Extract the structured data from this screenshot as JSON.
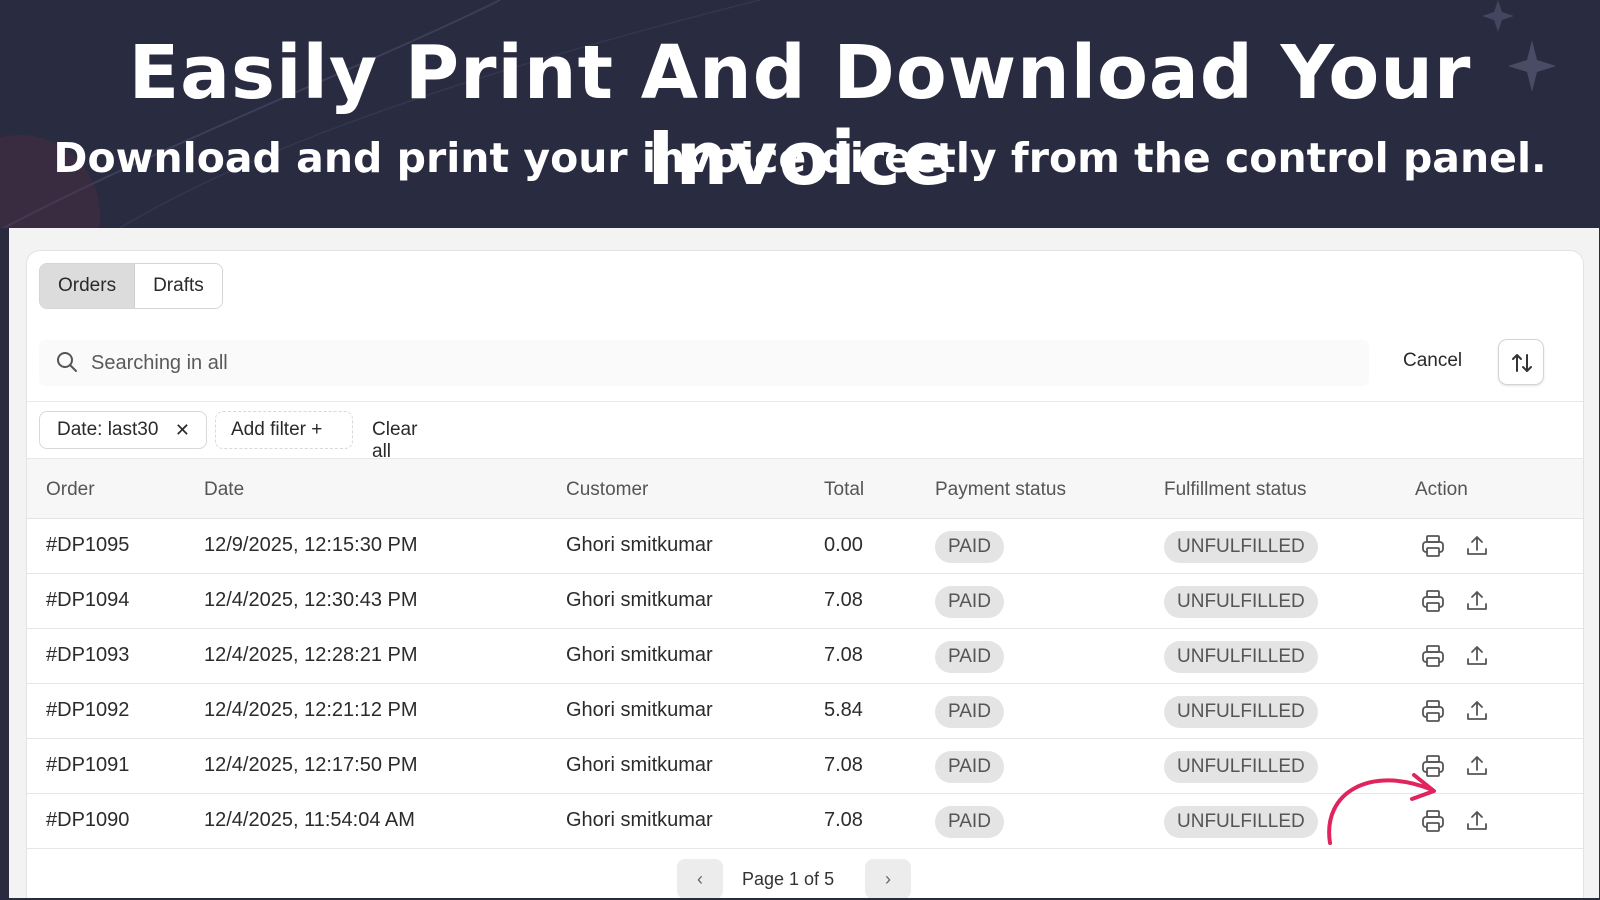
{
  "banner": {
    "title": "Easily Print And Download Your Invoice",
    "subtitle": "Download and print your invoice directly from the control panel."
  },
  "tabs": [
    {
      "label": "Orders",
      "active": true
    },
    {
      "label": "Drafts",
      "active": false
    }
  ],
  "search": {
    "placeholder": "Searching in all",
    "value": "",
    "cancel_label": "Cancel"
  },
  "filters": {
    "date_chip": "Date: last30",
    "add_filter": "Add filter +",
    "clear_all": "Clear all"
  },
  "table": {
    "columns": [
      "Order",
      "Date",
      "Customer",
      "Total",
      "Payment status",
      "Fulfillment status",
      "Action"
    ],
    "rows": [
      {
        "order": "#DP1095",
        "date": "12/9/2025, 12:15:30 PM",
        "customer": "Ghori smitkumar",
        "total": "0.00",
        "payment": "PAID",
        "fulfillment": "UNFULFILLED"
      },
      {
        "order": "#DP1094",
        "date": "12/4/2025, 12:30:43 PM",
        "customer": "Ghori smitkumar",
        "total": "7.08",
        "payment": "PAID",
        "fulfillment": "UNFULFILLED"
      },
      {
        "order": "#DP1093",
        "date": "12/4/2025, 12:28:21 PM",
        "customer": "Ghori smitkumar",
        "total": "7.08",
        "payment": "PAID",
        "fulfillment": "UNFULFILLED"
      },
      {
        "order": "#DP1092",
        "date": "12/4/2025, 12:21:12 PM",
        "customer": "Ghori smitkumar",
        "total": "5.84",
        "payment": "PAID",
        "fulfillment": "UNFULFILLED"
      },
      {
        "order": "#DP1091",
        "date": "12/4/2025, 12:17:50 PM",
        "customer": "Ghori smitkumar",
        "total": "7.08",
        "payment": "PAID",
        "fulfillment": "UNFULFILLED"
      },
      {
        "order": "#DP1090",
        "date": "12/4/2025, 11:54:04 AM",
        "customer": "Ghori smitkumar",
        "total": "7.08",
        "payment": "PAID",
        "fulfillment": "UNFULFILLED"
      }
    ],
    "row_action_icons": [
      "printer-icon",
      "upload-icon"
    ]
  },
  "pagination": {
    "label": "Page 1 of 5"
  },
  "colors": {
    "banner_bg": "#292b40",
    "accent_arrow": "#e0245e",
    "badge_bg": "#e4e4e4"
  }
}
